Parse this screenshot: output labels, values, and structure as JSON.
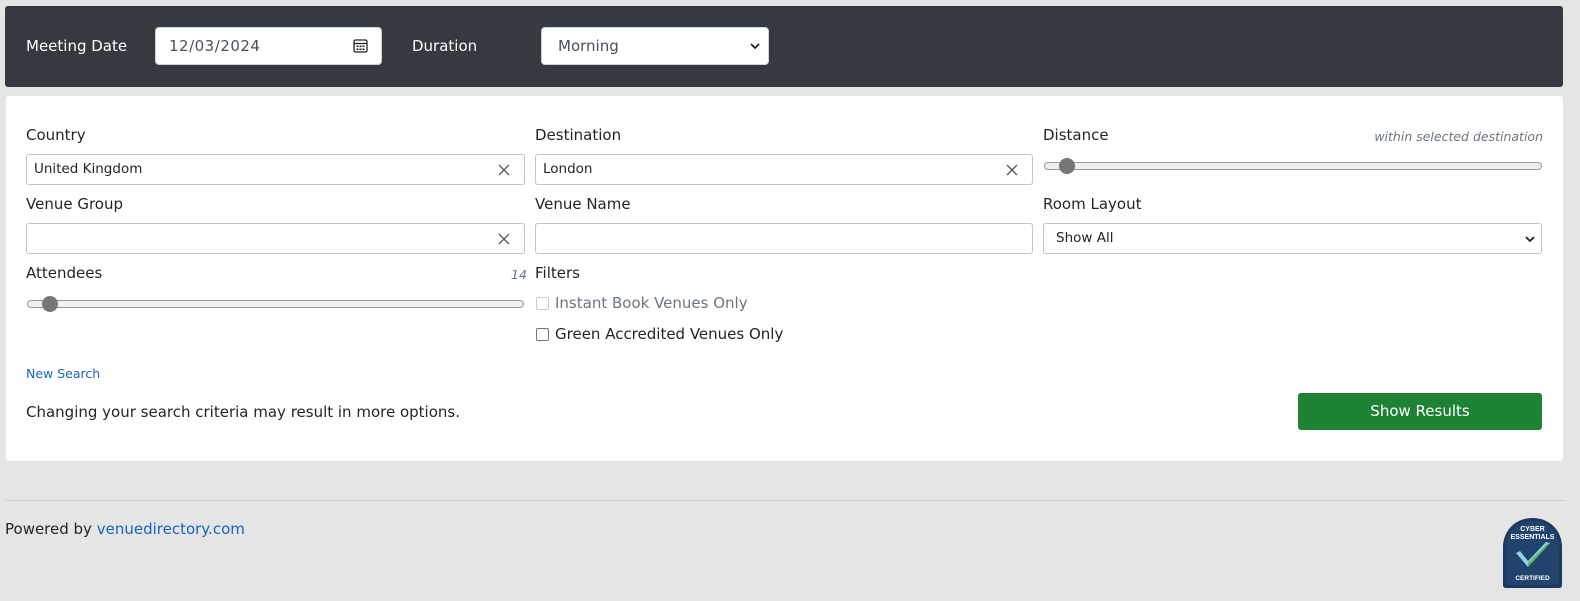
{
  "topbar": {
    "meeting_date_label": "Meeting Date",
    "meeting_date_value": "12/03/2024",
    "duration_label": "Duration",
    "duration_value": "Morning"
  },
  "search": {
    "country": {
      "label": "Country",
      "value": "United Kingdom"
    },
    "destination": {
      "label": "Destination",
      "value": "London"
    },
    "distance": {
      "label": "Distance",
      "hint": "within selected destination",
      "level": 0.03
    },
    "venue_group": {
      "label": "Venue Group",
      "value": ""
    },
    "venue_name": {
      "label": "Venue Name",
      "value": ""
    },
    "room_layout": {
      "label": "Room Layout",
      "value": "Show All"
    },
    "attendees": {
      "label": "Attendees",
      "value": "14",
      "level": 0.03
    },
    "filters": {
      "label": "Filters",
      "instant_book": {
        "label": "Instant Book Venues Only",
        "checked": false,
        "disabled": true
      },
      "green_accredited": {
        "label": "Green Accredited Venues Only",
        "checked": false
      }
    },
    "new_search_link": "New Search",
    "note": "Changing your search criteria may result in more options.",
    "show_results_button": "Show Results"
  },
  "footer": {
    "powered_by": "Powered by",
    "link_text": "venuedirectory.com",
    "badge": {
      "line1": "CYBER",
      "line2": "ESSENTIALS",
      "line3": "CERTIFIED"
    }
  },
  "colors": {
    "topbar_bg": "#343a40",
    "accent_green": "#1e8234",
    "link_blue": "#1565c0",
    "page_bg": "#e5e5e5"
  }
}
